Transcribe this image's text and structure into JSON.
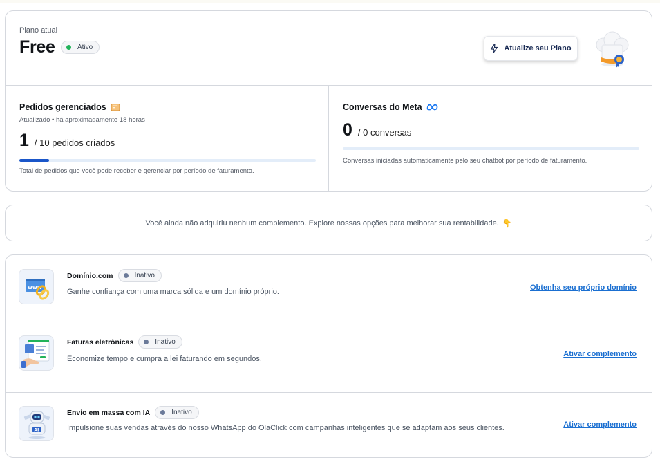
{
  "plan": {
    "label": "Plano atual",
    "name": "Free",
    "status": "Ativo",
    "upgrade_label": "Atualize seu Plano"
  },
  "orders": {
    "title": "Pedidos gerenciados",
    "updated": "Atualizado • há aproximadamente 18 horas",
    "count": "1",
    "count_suffix": "/ 10 pedidos criados",
    "progress": 0.1,
    "description": "Total de pedidos que você pode receber e gerenciar por período de faturamento."
  },
  "meta": {
    "title": "Conversas do Meta",
    "count": "0",
    "count_suffix": "/ 0 conversas",
    "progress": 0,
    "description": "Conversas iniciadas automaticamente pelo seu chatbot por período de faturamento."
  },
  "info_banner": "Você ainda não adquiriu nenhum complemento. Explore nossas opções para melhorar sua rentabilidade.",
  "addons": [
    {
      "name": "Domínio.com",
      "status": "Inativo",
      "description": "Ganhe confiança com uma marca sólida e um domínio próprio.",
      "action": "Obtenha seu próprio domínio",
      "icon": "www-chain-icon"
    },
    {
      "name": "Faturas eletrônicas",
      "status": "Inativo",
      "description": "Economize tempo e cumpra a lei faturando em segundos.",
      "action": "Ativar complemento",
      "icon": "invoice-screen-icon"
    },
    {
      "name": "Envio em massa com IA",
      "status": "Inativo",
      "description": "Impulsione suas vendas através do nosso WhatsApp do OlaClick com campanhas inteligentes que se adaptam aos seus clientes.",
      "action": "Ativar complemento",
      "icon": "ai-robot-icon"
    }
  ],
  "colors": {
    "accent": "#1a56c9",
    "link": "#1a6fd1",
    "active_dot": "#22b35a",
    "inactive_dot": "#6b7a99"
  }
}
